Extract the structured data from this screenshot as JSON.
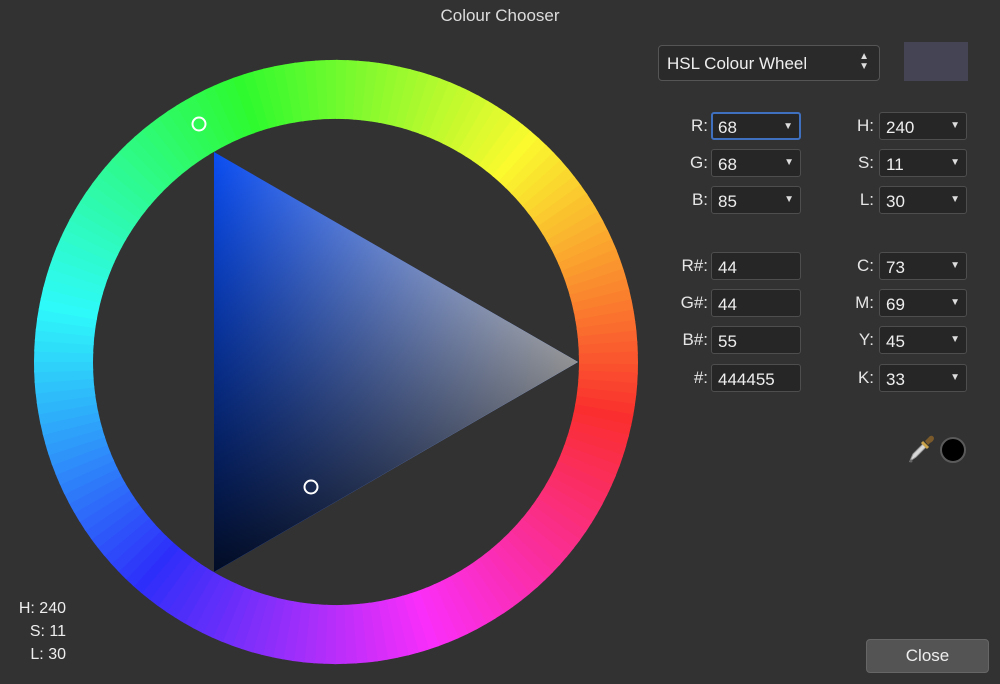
{
  "window": {
    "title": "Colour Chooser"
  },
  "mode_select": {
    "value": "HSL Colour Wheel"
  },
  "current_color": "#444455",
  "hue_ring_marker_color": "#0a4df2",
  "triangle_hue_color": "#0a4df2",
  "fields_left": [
    {
      "key": "R",
      "label": "R:",
      "value": "68",
      "dropdown": true,
      "focused": true
    },
    {
      "key": "G",
      "label": "G:",
      "value": "68",
      "dropdown": true
    },
    {
      "key": "B",
      "label": "B:",
      "value": "85",
      "dropdown": true
    },
    {
      "key": "R#",
      "label": "R#:",
      "value": "44",
      "dropdown": false
    },
    {
      "key": "G#",
      "label": "G#:",
      "value": "44",
      "dropdown": false
    },
    {
      "key": "B#",
      "label": "B#:",
      "value": "55",
      "dropdown": false
    },
    {
      "key": "hex",
      "label": "#:",
      "value": "444455",
      "dropdown": false
    }
  ],
  "fields_right": [
    {
      "key": "H",
      "label": "H:",
      "value": "240",
      "dropdown": true
    },
    {
      "key": "S",
      "label": "S:",
      "value": "11",
      "dropdown": true
    },
    {
      "key": "L",
      "label": "L:",
      "value": "30",
      "dropdown": true
    },
    {
      "key": "C",
      "label": "C:",
      "value": "73",
      "dropdown": true
    },
    {
      "key": "M",
      "label": "M:",
      "value": "69",
      "dropdown": true
    },
    {
      "key": "Y",
      "label": "Y:",
      "value": "45",
      "dropdown": true
    },
    {
      "key": "K",
      "label": "K:",
      "value": "33",
      "dropdown": true
    }
  ],
  "hsl_readout": {
    "h": "H: 240",
    "s": "S: 11",
    "l": "L: 30"
  },
  "picker": {
    "eyedropper_icon": "eyedropper-icon",
    "picked_color": "#000000"
  },
  "buttons": {
    "close": "Close"
  }
}
